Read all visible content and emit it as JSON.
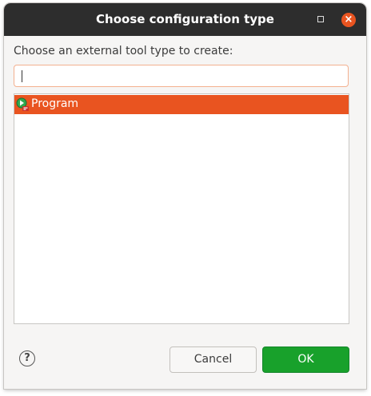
{
  "window": {
    "title": "Choose configuration type",
    "close_glyph": "×",
    "accent_color": "#e95420"
  },
  "prompt_label": "Choose an external tool type to create:",
  "filter": {
    "value": "",
    "placeholder": ""
  },
  "list": {
    "items": [
      {
        "label": "Program",
        "icon": "program-launch-icon",
        "selected": true
      }
    ]
  },
  "buttons": {
    "help_glyph": "?",
    "cancel_label": "Cancel",
    "ok_label": "OK",
    "ok_color": "#18a12b"
  }
}
